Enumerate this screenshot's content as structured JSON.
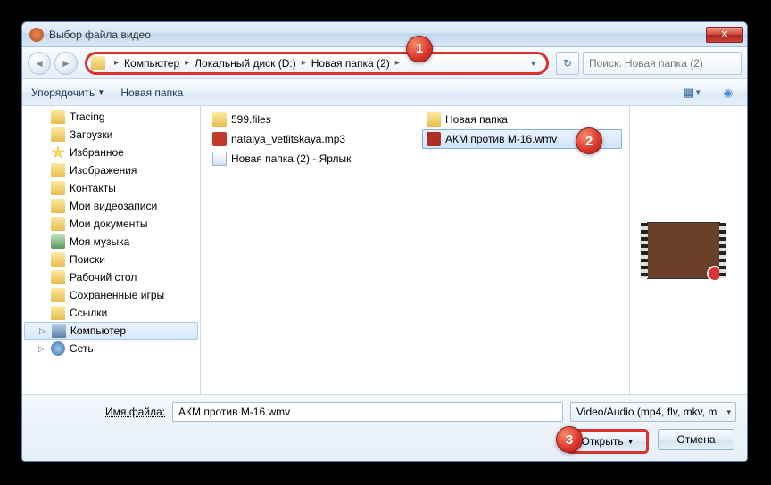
{
  "window": {
    "title": "Выбор файла видео"
  },
  "breadcrumb": {
    "parts": [
      "Компьютер",
      "Локальный диск (D:)",
      "Новая папка (2)"
    ]
  },
  "search": {
    "placeholder": "Поиск: Новая папка (2)"
  },
  "toolbar": {
    "organize": "Упорядочить",
    "new_folder": "Новая папка"
  },
  "sidebar": {
    "items": [
      {
        "label": "Tracing",
        "icon": "folder"
      },
      {
        "label": "Загрузки",
        "icon": "folder"
      },
      {
        "label": "Избранное",
        "icon": "star"
      },
      {
        "label": "Изображения",
        "icon": "folder"
      },
      {
        "label": "Контакты",
        "icon": "folder"
      },
      {
        "label": "Мои видеозаписи",
        "icon": "folder"
      },
      {
        "label": "Мои документы",
        "icon": "folder"
      },
      {
        "label": "Моя музыка",
        "icon": "music"
      },
      {
        "label": "Поиски",
        "icon": "folder"
      },
      {
        "label": "Рабочий стол",
        "icon": "folder"
      },
      {
        "label": "Сохраненные игры",
        "icon": "folder"
      },
      {
        "label": "Ссылки",
        "icon": "folder"
      }
    ],
    "computer": "Компьютер",
    "network": "Сеть"
  },
  "files": {
    "col1": [
      {
        "label": "599.files",
        "icon": "folder"
      },
      {
        "label": "natalya_vetlitskaya.mp3",
        "icon": "audio"
      },
      {
        "label": "Новая папка (2) - Ярлык",
        "icon": "link"
      }
    ],
    "col2": [
      {
        "label": "Новая папка",
        "icon": "folder"
      },
      {
        "label": "АКМ против М-16.wmv",
        "icon": "video",
        "selected": true
      }
    ]
  },
  "footer": {
    "filename_label": "Имя файла:",
    "filename_value": "АКМ против М-16.wmv",
    "filter": "Video/Audio (mp4, flv, mkv, m",
    "open": "Открыть",
    "cancel": "Отмена"
  },
  "callouts": {
    "c1": "1",
    "c2": "2",
    "c3": "3"
  }
}
